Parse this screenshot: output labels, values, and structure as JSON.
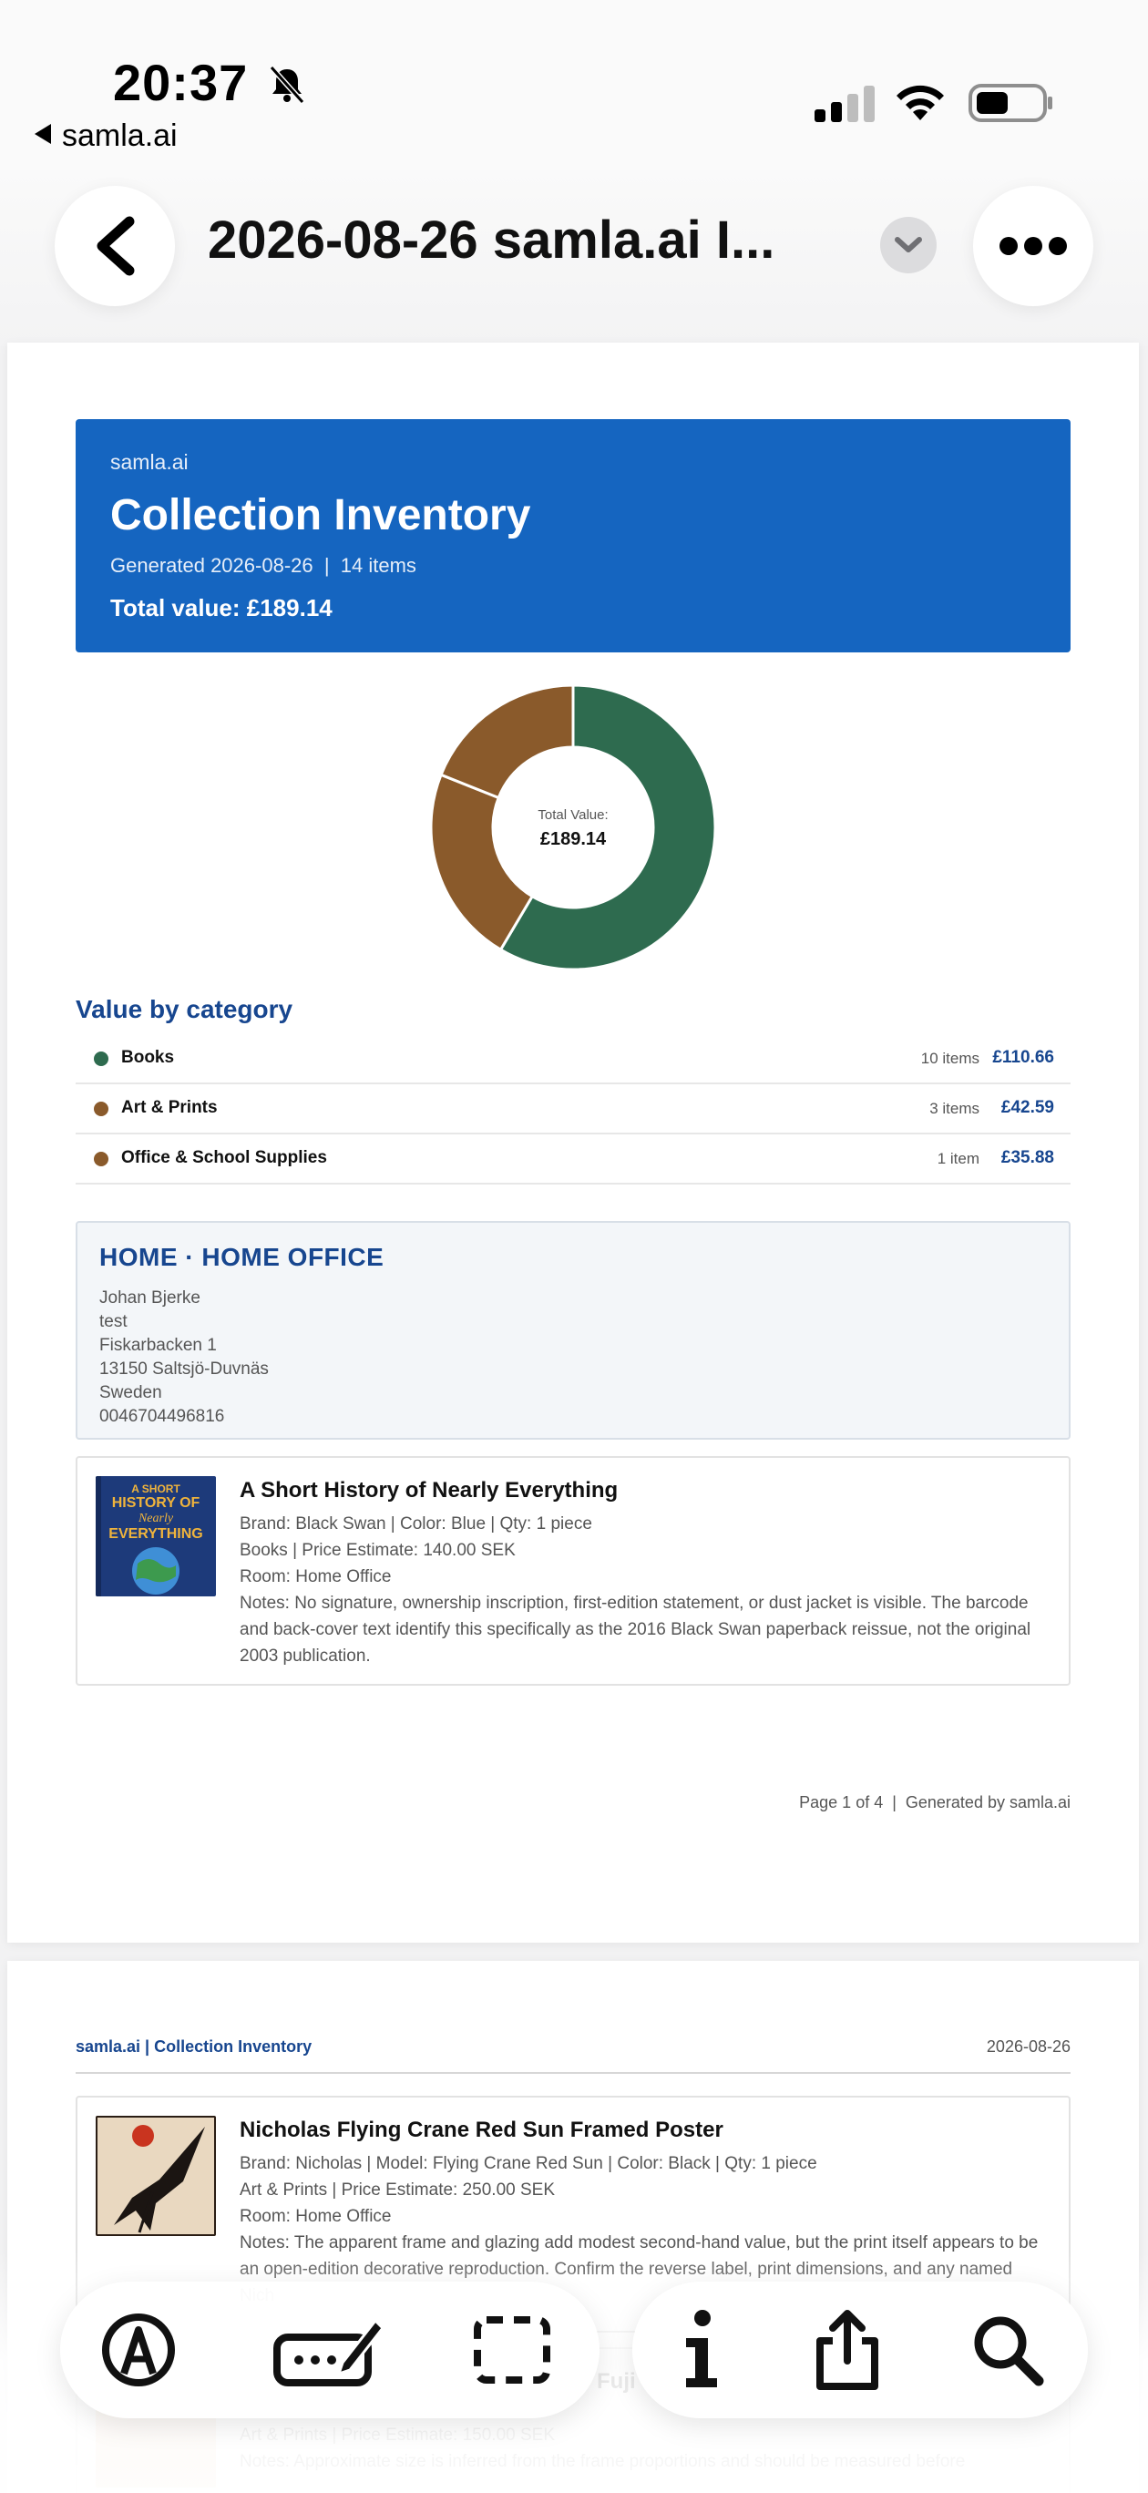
{
  "status_bar": {
    "time": "20:37",
    "back_app": "samla.ai",
    "icons": [
      "bell-slash-icon",
      "cellular-signal-icon",
      "wifi-icon",
      "battery-icon"
    ]
  },
  "nav": {
    "title": "2026-08-26 samla.ai I...",
    "icons": [
      "chevron-left-icon",
      "chevron-down-icon",
      "more-icon"
    ]
  },
  "page1": {
    "header": {
      "brand": "samla.ai",
      "title": "Collection Inventory",
      "meta": "Generated 2026-08-26  |  14 items",
      "total": "Total value: £189.14"
    },
    "donut": {
      "center_label": "Total Value:",
      "center_value": "£189.14"
    },
    "section_title": "Value by category",
    "categories": [
      {
        "name": "Books",
        "count": "10 items",
        "value": "£110.66",
        "amount": 110.66,
        "color": "#2e6b4f"
      },
      {
        "name": "Art & Prints",
        "count": "3 items",
        "value": "£42.59",
        "amount": 42.59,
        "color": "#8a5a2b"
      },
      {
        "name": "Office & School Supplies",
        "count": "1 item",
        "value": "£35.88",
        "amount": 35.88,
        "color": "#8a5a2b"
      }
    ],
    "room": {
      "title": "HOME · HOME OFFICE",
      "lines": [
        "Johan Bjerke",
        "test",
        "Fiskarbacken 1",
        "13150 Saltsjö-Duvnäs",
        "Sweden",
        "0046704496816"
      ]
    },
    "item": {
      "name": "A Short History of Nearly Everything",
      "thumb_text": "A SHORT HISTORY OF Nearly EVERYTHING",
      "lines": [
        "Brand: Black Swan | Color: Blue | Qty: 1 piece",
        "Books | Price Estimate: 140.00 SEK",
        "Room: Home Office",
        "Notes: No signature, ownership inscription, first-edition statement, or dust jacket is visible. The barcode and back-cover text identify this specifically as the 2016 Black Swan paperback reissue, not the original 2003 publication."
      ]
    },
    "footer": "Page 1 of 4  |  Generated by samla.ai"
  },
  "page2": {
    "header_left": "samla.ai | Collection Inventory",
    "header_right": "2026-08-26",
    "item": {
      "name": "Nicholas Flying Crane Red Sun Framed Poster",
      "lines": [
        "Brand: Nicholas | Model: Flying Crane Red Sun | Color: Black | Qty: 1 piece",
        "Art & Prints | Price Estimate: 250.00 SEK",
        "Room: Home Office",
        "Notes: The apparent frame and glazing add modest second-hand value, but the print itself appears to be an open-edition decorative reproduction. Confirm the reverse label, print dimensions, and any named Nich"
      ]
    },
    "item2_partial": {
      "name": "Fuji",
      "lines": [
        "Art & Prints | Price Estimate: 150.00 SEK",
        "Notes: Approximate size is inferred from the frame proportions and should be measured before"
      ]
    }
  },
  "toolbar": {
    "icons": [
      "markup-icon",
      "edit-text-icon",
      "select-region-icon",
      "info-icon",
      "share-icon",
      "search-icon"
    ]
  },
  "colors": {
    "brand_blue": "#1565c0",
    "heading_blue": "#17468f",
    "books_green": "#2e6b4f",
    "art_brown": "#8a5a2b"
  }
}
